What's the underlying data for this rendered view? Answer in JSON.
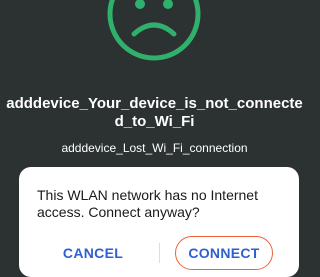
{
  "colors": {
    "background": "#2c3132",
    "accent_green": "#2fb06c",
    "button_text": "#2f5fd0",
    "focus_ring": "#f0603a",
    "dialog_bg": "#ffffff"
  },
  "error": {
    "icon": "sad-face-icon",
    "title": "adddevice_Your_device_is_not_connected_to_Wi_Fi",
    "subtitle": "adddevice_Lost_Wi_Fi_connection"
  },
  "dialog": {
    "message": "This WLAN network has no Internet access. Connect anyway?",
    "cancel_label": "CANCEL",
    "connect_label": "CONNECT"
  }
}
